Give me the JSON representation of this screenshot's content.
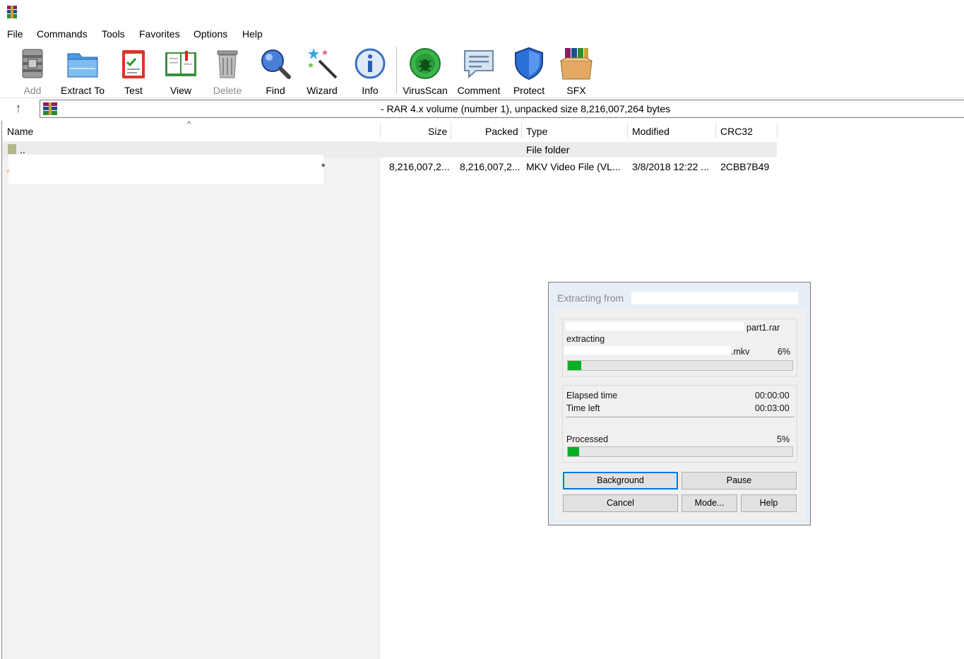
{
  "menu": [
    "File",
    "Commands",
    "Tools",
    "Favorites",
    "Options",
    "Help"
  ],
  "toolbar": [
    {
      "label": "Add",
      "icon": "add-archive-icon",
      "disabled": true
    },
    {
      "label": "Extract To",
      "icon": "extract-folder-icon",
      "disabled": false
    },
    {
      "label": "Test",
      "icon": "test-clipboard-icon",
      "disabled": false
    },
    {
      "label": "View",
      "icon": "view-book-icon",
      "disabled": false
    },
    {
      "label": "Delete",
      "icon": "trash-icon",
      "disabled": true
    },
    {
      "label": "Find",
      "icon": "magnifier-icon",
      "disabled": false
    },
    {
      "label": "Wizard",
      "icon": "magic-wand-icon",
      "disabled": false
    },
    {
      "label": "Info",
      "icon": "info-icon",
      "disabled": false
    },
    {
      "label": "VirusScan",
      "icon": "virus-scan-icon",
      "disabled": false
    },
    {
      "label": "Comment",
      "icon": "comment-icon",
      "disabled": false
    },
    {
      "label": "Protect",
      "icon": "shield-icon",
      "disabled": false
    },
    {
      "label": "SFX",
      "icon": "sfx-box-icon",
      "disabled": false
    }
  ],
  "address": {
    "text": "- RAR 4.x volume (number 1), unpacked size 8,216,007,264 bytes"
  },
  "columns": {
    "name": "Name",
    "size": "Size",
    "packed": "Packed",
    "type": "Type",
    "modified": "Modified",
    "crc": "CRC32"
  },
  "rows": [
    {
      "name": "..",
      "size": "",
      "packed": "",
      "type": "File folder",
      "modified": "",
      "crc": ""
    },
    {
      "name": "*",
      "size": "8,216,007,2...",
      "packed": "8,216,007,2...",
      "type": "MKV Video File (VL...",
      "modified": "3/8/2018 12:22 ...",
      "crc": "2CBB7B49"
    }
  ],
  "dialog": {
    "title": "Extracting from",
    "archive_suffix": "part1.rar",
    "action": "extracting",
    "file_suffix": ".mkv",
    "file_percent": "6%",
    "file_progress": 0.06,
    "elapsed_label": "Elapsed time",
    "elapsed_value": "00:00:00",
    "left_label": "Time left",
    "left_value": "00:03:00",
    "processed_label": "Processed",
    "processed_percent": "5%",
    "processed_progress": 0.05,
    "buttons": {
      "background": "Background",
      "pause": "Pause",
      "cancel": "Cancel",
      "mode": "Mode...",
      "help": "Help"
    }
  },
  "colors": {
    "progress": "#06b025",
    "accent": "#0078d7"
  }
}
